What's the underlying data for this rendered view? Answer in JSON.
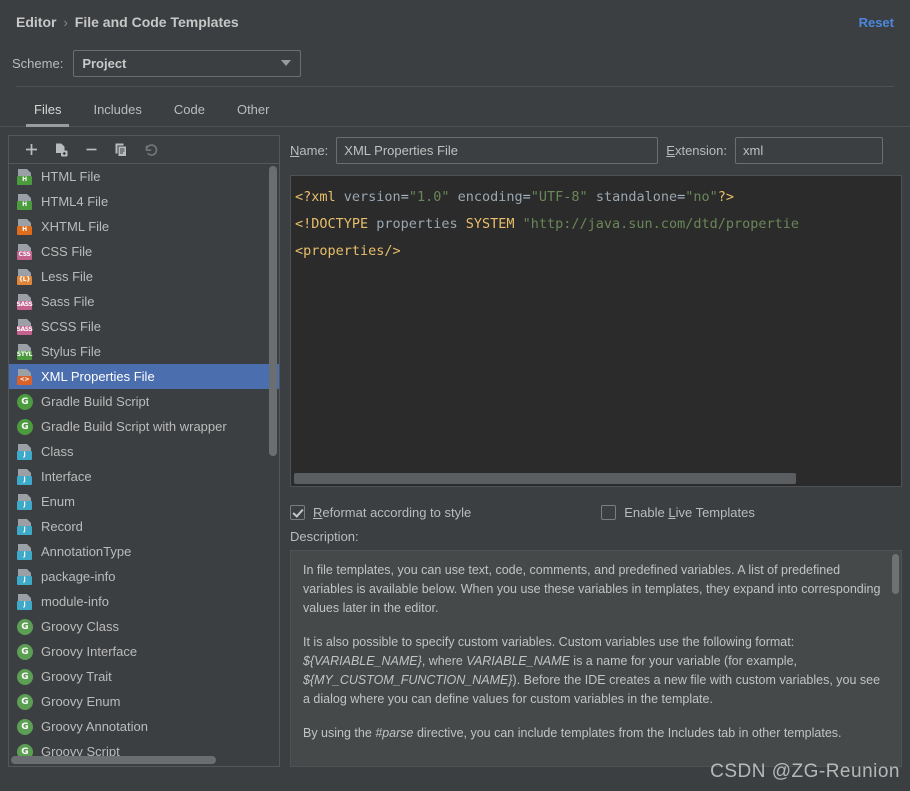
{
  "header": {
    "breadcrumb_parent": "Editor",
    "breadcrumb_sep": "›",
    "breadcrumb_current": "File and Code Templates",
    "reset_label": "Reset"
  },
  "scheme": {
    "label": "Scheme:",
    "value": "Project",
    "arrow_icon": "chevron-down-icon"
  },
  "tabs": [
    {
      "label": "Files",
      "active": true
    },
    {
      "label": "Includes",
      "active": false
    },
    {
      "label": "Code",
      "active": false
    },
    {
      "label": "Other",
      "active": false
    }
  ],
  "toolbar": {
    "add_label": "+",
    "items": [
      {
        "name": "add-icon",
        "title": "Add"
      },
      {
        "name": "add-from-file-icon",
        "title": "Create Template from File"
      },
      {
        "name": "remove-icon",
        "title": "Remove"
      },
      {
        "name": "copy-icon",
        "title": "Copy"
      },
      {
        "name": "revert-icon",
        "title": "Reset to Default"
      }
    ]
  },
  "template_list": {
    "selected": "XML Properties File",
    "items": [
      {
        "label": "HTML File",
        "icon": "file",
        "badge": "H",
        "badge_color": "#4d9b3f",
        "text_color": "#ffffff"
      },
      {
        "label": "HTML4 File",
        "icon": "file",
        "badge": "H",
        "badge_color": "#4d9b3f",
        "text_color": "#ffffff"
      },
      {
        "label": "XHTML File",
        "icon": "file",
        "badge": "H",
        "badge_color": "#e06c1e",
        "text_color": "#ffffff"
      },
      {
        "label": "CSS File",
        "icon": "file",
        "badge": "CSS",
        "badge_color": "#c4618c",
        "text_color": "#ffffff"
      },
      {
        "label": "Less File",
        "icon": "file",
        "badge": "{L}",
        "badge_color": "#e0853a",
        "text_color": "#ffffff"
      },
      {
        "label": "Sass File",
        "icon": "file",
        "badge": "SASS",
        "badge_color": "#c4618c",
        "text_color": "#ffffff"
      },
      {
        "label": "SCSS File",
        "icon": "file",
        "badge": "SASS",
        "badge_color": "#c4618c",
        "text_color": "#ffffff"
      },
      {
        "label": "Stylus File",
        "icon": "file",
        "badge": "STYL",
        "badge_color": "#4d9b3f",
        "text_color": "#ffffff"
      },
      {
        "label": "XML Properties File",
        "icon": "file",
        "badge": "<>",
        "badge_color": "#d9622b",
        "text_color": "#ffffff"
      },
      {
        "label": "Gradle Build Script",
        "icon": "circle",
        "badge": "G",
        "badge_color": "#4d9b3f",
        "text_color": "#ffffff"
      },
      {
        "label": "Gradle Build Script with wrapper",
        "icon": "circle",
        "badge": "G",
        "badge_color": "#4d9b3f",
        "text_color": "#ffffff"
      },
      {
        "label": "Class",
        "icon": "file",
        "badge": "J",
        "badge_color": "#3fa9c9",
        "text_color": "#ffffff"
      },
      {
        "label": "Interface",
        "icon": "file",
        "badge": "J",
        "badge_color": "#3fa9c9",
        "text_color": "#ffffff"
      },
      {
        "label": "Enum",
        "icon": "file",
        "badge": "J",
        "badge_color": "#3fa9c9",
        "text_color": "#ffffff"
      },
      {
        "label": "Record",
        "icon": "file",
        "badge": "J",
        "badge_color": "#3fa9c9",
        "text_color": "#ffffff"
      },
      {
        "label": "AnnotationType",
        "icon": "file",
        "badge": "J",
        "badge_color": "#3fa9c9",
        "text_color": "#ffffff"
      },
      {
        "label": "package-info",
        "icon": "file",
        "badge": "J",
        "badge_color": "#3fa9c9",
        "text_color": "#ffffff"
      },
      {
        "label": "module-info",
        "icon": "file",
        "badge": "J",
        "badge_color": "#3fa9c9",
        "text_color": "#ffffff"
      },
      {
        "label": "Groovy Class",
        "icon": "circle",
        "badge": "G",
        "badge_color": "#5c9e54",
        "text_color": "#ffffff"
      },
      {
        "label": "Groovy Interface",
        "icon": "circle",
        "badge": "G",
        "badge_color": "#5c9e54",
        "text_color": "#ffffff"
      },
      {
        "label": "Groovy Trait",
        "icon": "circle",
        "badge": "G",
        "badge_color": "#5c9e54",
        "text_color": "#ffffff"
      },
      {
        "label": "Groovy Enum",
        "icon": "circle",
        "badge": "G",
        "badge_color": "#5c9e54",
        "text_color": "#ffffff"
      },
      {
        "label": "Groovy Annotation",
        "icon": "circle",
        "badge": "G",
        "badge_color": "#5c9e54",
        "text_color": "#ffffff"
      },
      {
        "label": "Groovy Script",
        "icon": "circle",
        "badge": "G",
        "badge_color": "#5c9e54",
        "text_color": "#ffffff"
      }
    ]
  },
  "form": {
    "name_label_mnemonic": "N",
    "name_label_rest": "ame:",
    "name_value": "XML Properties File",
    "ext_label_mnemonic": "E",
    "ext_label_rest": "xtension:",
    "ext_value": "xml"
  },
  "editor": {
    "lines": [
      [
        {
          "t": "<?xml",
          "c": "tag"
        },
        {
          "t": " ",
          "c": "plain"
        },
        {
          "t": "version",
          "c": "attr"
        },
        {
          "t": "=",
          "c": "plain"
        },
        {
          "t": "\"1.0\"",
          "c": "str"
        },
        {
          "t": " ",
          "c": "plain"
        },
        {
          "t": "encoding",
          "c": "attr"
        },
        {
          "t": "=",
          "c": "plain"
        },
        {
          "t": "\"UTF-8\"",
          "c": "str"
        },
        {
          "t": " ",
          "c": "plain"
        },
        {
          "t": "standalone",
          "c": "attr"
        },
        {
          "t": "=",
          "c": "plain"
        },
        {
          "t": "\"no\"",
          "c": "str"
        },
        {
          "t": "?>",
          "c": "tag"
        }
      ],
      [
        {
          "t": "<!DOCTYPE",
          "c": "tag"
        },
        {
          "t": " ",
          "c": "plain"
        },
        {
          "t": "properties",
          "c": "attr"
        },
        {
          "t": " ",
          "c": "plain"
        },
        {
          "t": "SYSTEM",
          "c": "tag"
        },
        {
          "t": " ",
          "c": "plain"
        },
        {
          "t": "\"http://java.sun.com/dtd/propertie",
          "c": "str"
        }
      ],
      [
        {
          "t": "<properties/>",
          "c": "tag"
        }
      ]
    ]
  },
  "options": {
    "reformat_mnemonic": "R",
    "reformat_rest": "eformat according to style",
    "reformat_checked": true,
    "live_templates_pre": "Enable ",
    "live_templates_mnemonic": "L",
    "live_templates_rest": "ive Templates",
    "live_templates_checked": false
  },
  "description": {
    "label": "Description:",
    "paragraphs": [
      "In file templates, you can use text, code, comments, and predefined variables. A list of predefined variables is available below. When you use these variables in templates, they expand into corresponding values later in the editor."
    ],
    "p2_parts": [
      {
        "t": "It is also possible to specify custom variables. Custom variables use the following format: ",
        "i": false
      },
      {
        "t": "${VARIABLE_NAME}",
        "i": true
      },
      {
        "t": ", where ",
        "i": false
      },
      {
        "t": "VARIABLE_NAME",
        "i": true
      },
      {
        "t": " is a name for your variable (for example, ",
        "i": false
      },
      {
        "t": "${MY_CUSTOM_FUNCTION_NAME}",
        "i": true
      },
      {
        "t": "). Before the IDE creates a new file with custom variables, you see a dialog where you can define values for custom variables in the template.",
        "i": false
      }
    ],
    "p3_parts": [
      {
        "t": "By using the ",
        "i": false
      },
      {
        "t": "#parse",
        "i": true
      },
      {
        "t": " directive, you can include templates from the Includes tab in other templates.",
        "i": false
      }
    ]
  },
  "watermark": "CSDN @ZG-Reunion"
}
